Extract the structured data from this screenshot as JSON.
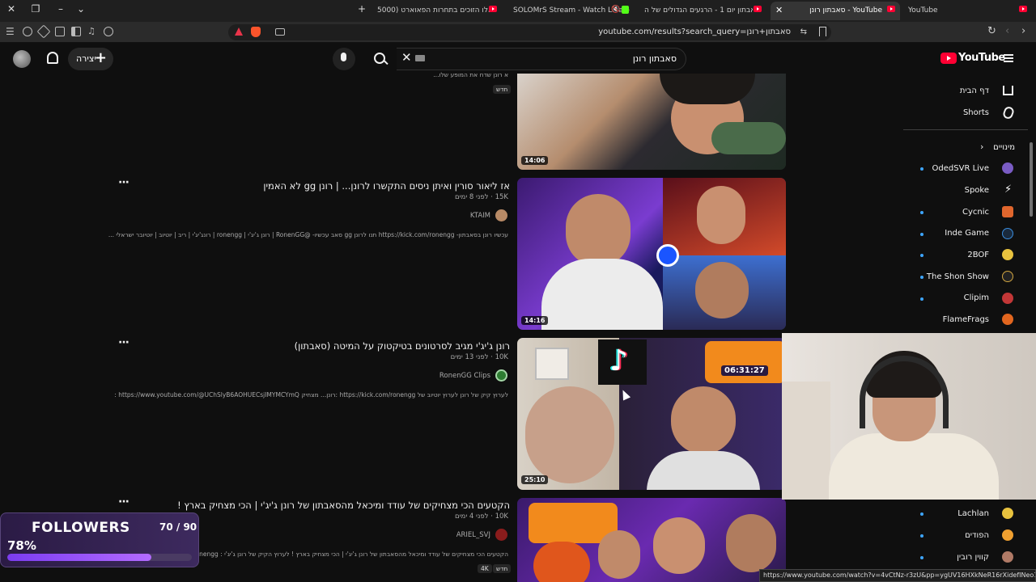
{
  "browser": {
    "tabs": [
      {
        "label": "אלו הזוכים בתחרות הפאוארט (5000"
      },
      {
        "label": "SOLOMrS Stream - Watch Live on"
      },
      {
        "label": "סאבתון יום 1 - הרגעים הגדולים של ה"
      },
      {
        "label": "סאבתון רונן - YouTube"
      },
      {
        "label": "YouTube"
      }
    ],
    "url": "youtube.com/results?search_query=סאבתון+רונן"
  },
  "masthead": {
    "create_label": "יצירה",
    "search_value": "סאבתון רונן",
    "logo_text": "YouTube"
  },
  "sidebar": {
    "home": "דף הבית",
    "shorts": "Shorts",
    "subscriptions": "מינויים",
    "channels": [
      "OdedSVR Live",
      "Spoke",
      "Cycnic",
      "Inde Game",
      "2BOF",
      "The Shon Show",
      "Clipim",
      "FlameFrags"
    ],
    "bottom_channels": [
      "Lachlan",
      "הפודים",
      "קווין רובין"
    ]
  },
  "results": [
    {
      "title": "",
      "desc": "א רונן שדח את המופע שלו...",
      "badge": "חדש",
      "duration": "14:06"
    },
    {
      "title": "אז ליאור סורין ואיתן ניסים התקשרו לרונן... | רונן gg לא האמין",
      "meta": "15K · לפני 8 ימים",
      "channel": "KTAIM",
      "desc": "עכשיו רונן בסאבתון- https://kick.com/ronengg תנו לרונן gg סאב עכשיו- @RonenGG | רונן ג'יג'י | ronengg | רונג'יג'י | ריב | יוטיוב | יוטיובר ישראלי ...",
      "duration": "14:16"
    },
    {
      "title": "רונן ג'יג'י מגיב לסרטונים בטיקטוק על המיטה (סאבתון)",
      "meta": "10K · לפני 13 ימים",
      "channel": "RonenGG Clips",
      "desc": "לערוץ קיק של רונן לערוץ יוטיוב של https://kick.com/ronengg :רונן... מצחיק https://www.youtube.com/@UChSlyB6AOHUECsjIMYMCYmQ :",
      "duration": "25:10"
    },
    {
      "title": "הקטעים הכי מצחיקים של עודד ומיכאל מהסאבתון של רונן ג'יג'י | הכי מצחיק בארץ !",
      "meta": "10K · לפני 4 ימים",
      "channel": "ARIEL_SVJ",
      "desc": "הקטעים הכי מצחיקים של עודד ומיכאל מהסאבתון של רונן ג'יג'י | הכי מצחיק בארץ ! לערוץ הקיק של רונן ג'יג'י : https://kick.com/ronengg",
      "badges": [
        "4K",
        "חדש"
      ]
    }
  ],
  "thumb_text": {
    "timer": "06:31:27"
  },
  "followers": {
    "title": "FOLLOWERS",
    "count": "70 / 90",
    "percent_label": "78%",
    "percent": 78
  },
  "status_url": "https://www.youtube.com/watch?v=4vCtNz-r3zU&pp=ygUV16HXkNeR16rXidefINeo15XXoNef",
  "colors": {
    "accent": "#ff0033",
    "bg": "#0f0f0f",
    "followers_bar": "#9b55ff"
  }
}
